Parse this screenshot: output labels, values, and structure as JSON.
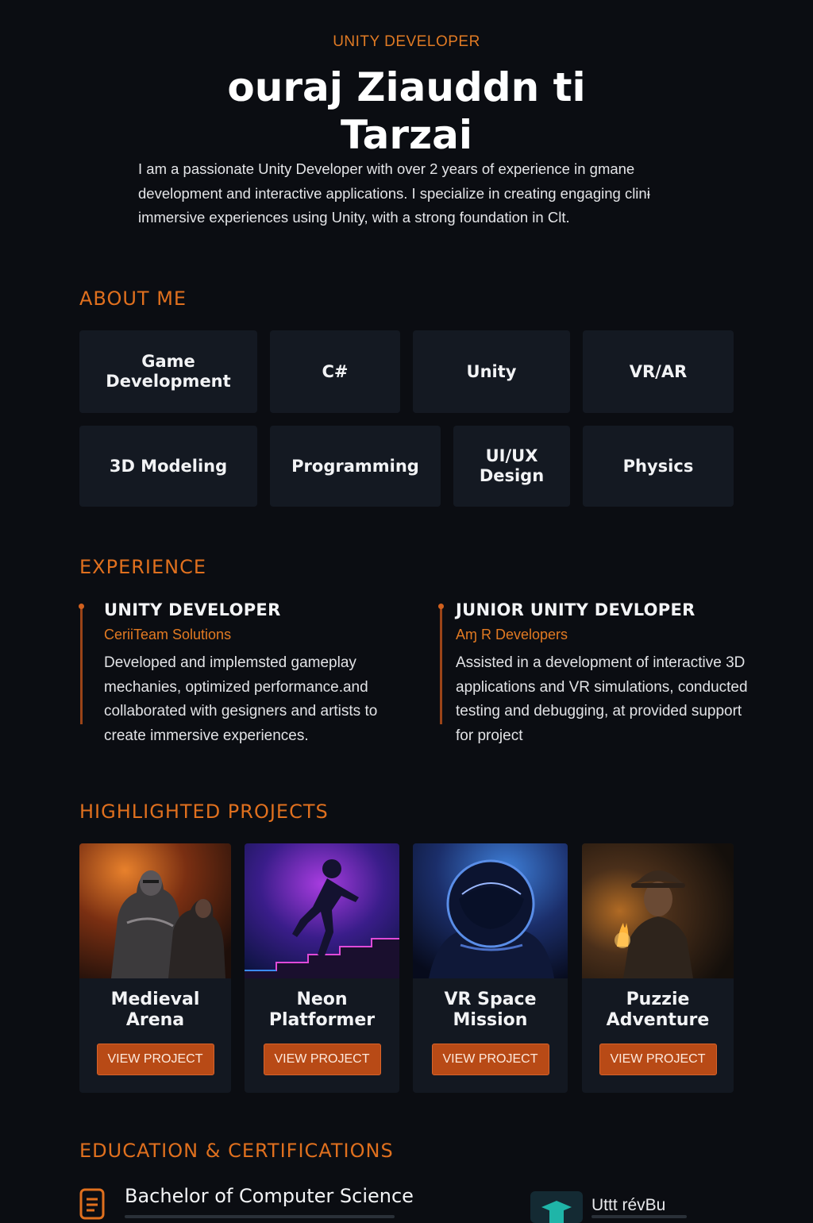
{
  "hero": {
    "eyebrow": "UNITY DEVELOPER",
    "name_line1": "ouraj Ziauddn ti",
    "name_line2": "Tarzai",
    "intro": "I am a passionate Unity Developer with over 2 years of experience in gmane development and interactive applications. I specialize in creating engaging clinɨ immersive experiences using Unity, with a strong foundation in Clt."
  },
  "about": {
    "title": "ABOUT ME",
    "skills": [
      "Game Development",
      "C#",
      "Unity",
      "VR/AR",
      "3D Modeling",
      "Programming",
      "UI/UX Design",
      "Physics"
    ]
  },
  "experience": {
    "title": "EXPERIENCE",
    "items": [
      {
        "role": "UNITY DEVELOPER",
        "company": "CeriiTeam Solutions",
        "description": "Developed and implemsted gameplay mechanies, optimized performance.and collaborated with gesigners and artists to create immersive experiences."
      },
      {
        "role": "JUNIOR UNITY DEVLOPER",
        "company": "Aɱ R Developers",
        "description": "Assisted in a development of interactive 3D applications and VR simulations, conducted testing and debugging, at provided support for project"
      }
    ]
  },
  "projects": {
    "title": "HIGHLIGHTED PROJECTS",
    "items": [
      {
        "title": "Medieval Arena",
        "button": "VIEW PROJECT"
      },
      {
        "title": "Neon Platformer",
        "button": "VIEW PROJECT"
      },
      {
        "title": "VR Space Mission",
        "button": "VIEW PROJECT"
      },
      {
        "title": "Puzzie Adventure",
        "button": "VIEW PROJECT"
      }
    ]
  },
  "education": {
    "title": "EDUCATION & CERTIFICATIONS",
    "degree": "Bachelor of Computer Science",
    "certificate": "Uttt révBu"
  },
  "colors": {
    "background": "#0b0d12",
    "accent": "#e0701e",
    "card": "#141922",
    "button": "#b84a16"
  }
}
